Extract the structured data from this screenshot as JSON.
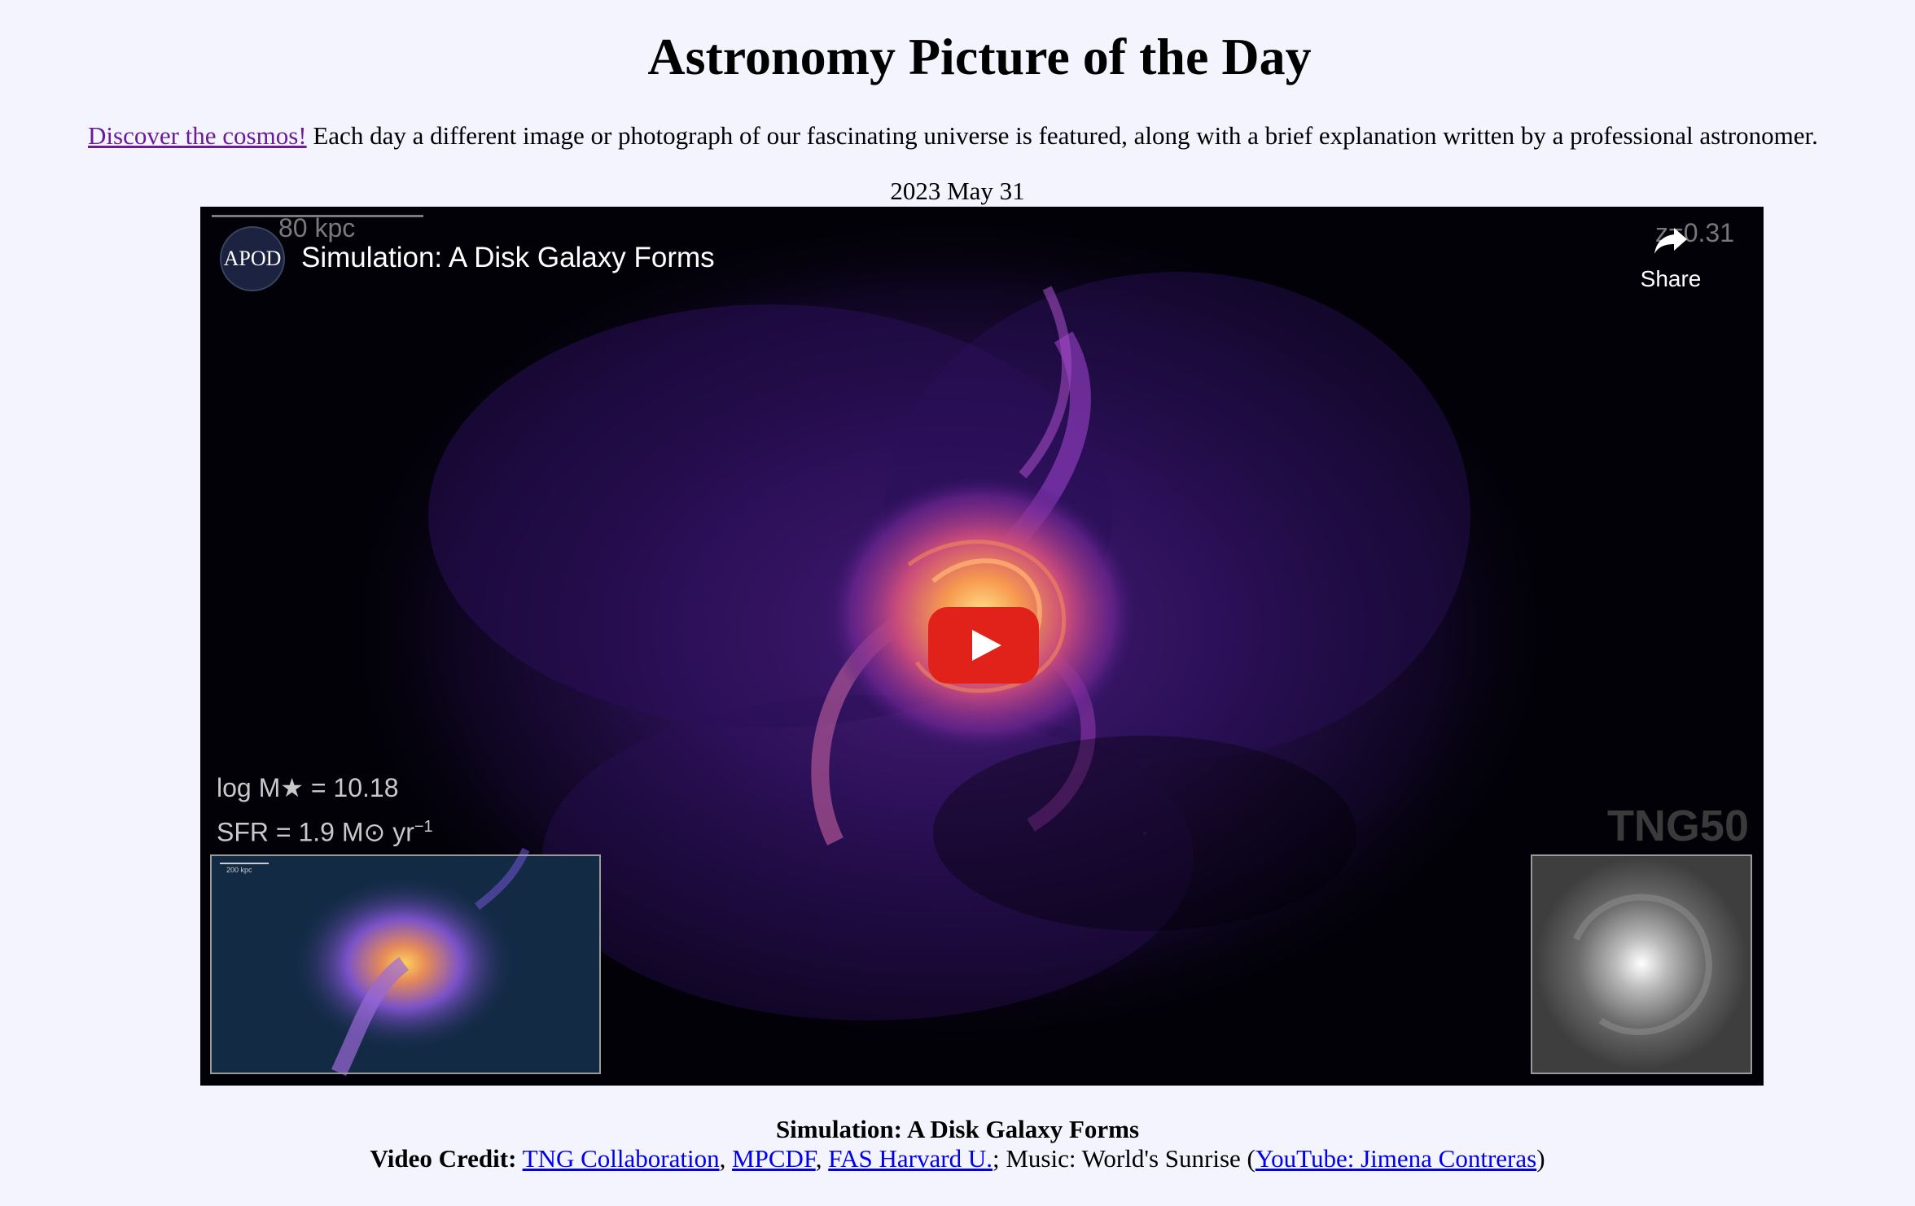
{
  "page": {
    "title": "Astronomy Picture of the Day",
    "intro_link": "Discover the cosmos!",
    "intro_text": " Each day a different image or photograph of our fascinating universe is featured, along with a brief explanation written by a professional astronomer.",
    "date": "2023 May 31"
  },
  "video": {
    "channel_logo": "APOD",
    "title": "Simulation: A Disk Galaxy Forms",
    "share_label": "Share",
    "scale_label": "80 kpc",
    "redshift_label": "z=0.31",
    "stat_mass": "log M★ = 10.18",
    "stat_sfr": "SFR = 1.9 M⊙ yr",
    "stat_sfr_exp": "−1",
    "watermark": "TNG50",
    "inset_scale": "200 kpc",
    "play_icon": "play-icon",
    "share_icon": "share-arrow-icon"
  },
  "caption": {
    "title": "Simulation: A Disk Galaxy Forms",
    "credit_label": "Video Credit:",
    "links": [
      "TNG Collaboration",
      "MPCDF",
      "FAS Harvard U."
    ],
    "sep1": ", ",
    "sep2": ", ",
    "music_text": "; Music: World's Sunrise (",
    "music_link": "YouTube: Jimena Contreras",
    "close_paren": ")"
  },
  "colors": {
    "background": "#f3f4fd",
    "visited_link": "#6a1b9a",
    "link": "#0000ee",
    "play_button": "#e1221b"
  }
}
